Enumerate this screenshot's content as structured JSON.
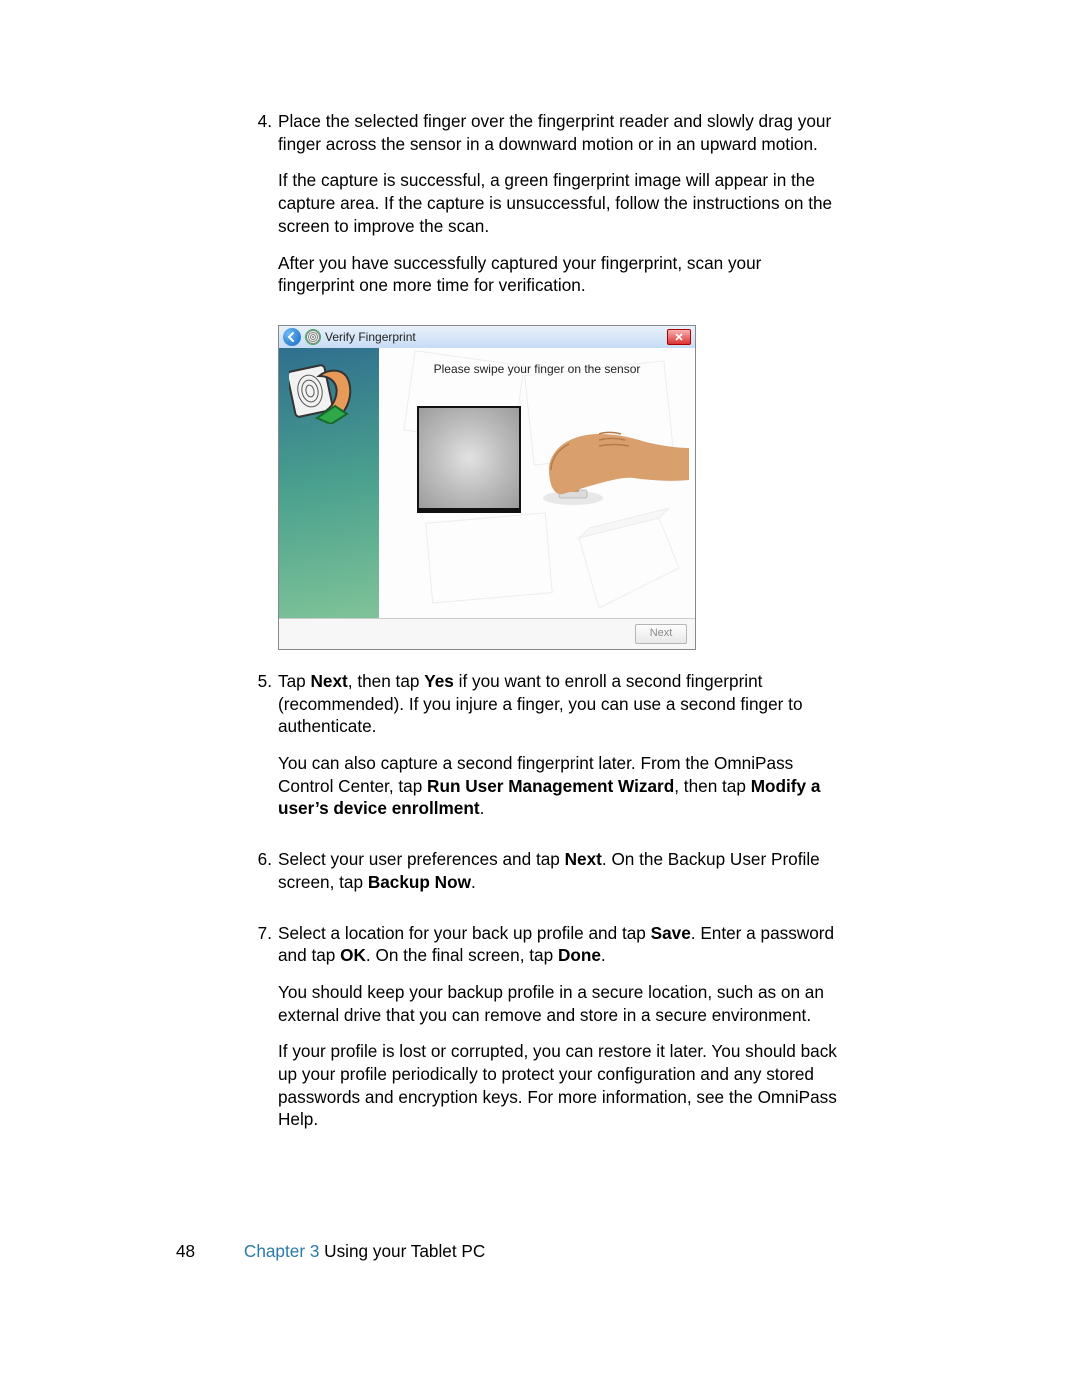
{
  "step4": {
    "num": "4.",
    "line1": "Place the selected finger over the fingerprint reader and slowly drag your finger across the sensor in a downward motion or in an upward motion.",
    "p2": "If the capture is successful, a green fingerprint image will appear in the capture area. If the capture is unsuccessful, follow the instructions on the screen to improve the scan.",
    "p3": "After you have successfully captured your fingerprint, scan your fingerprint one more time for verification."
  },
  "dialog": {
    "title": "Verify Fingerprint",
    "prompt": "Please swipe your finger on the sensor",
    "next_label": "Next",
    "close_label": "x"
  },
  "step5": {
    "num": "5.",
    "tap": "Tap ",
    "next_b": "Next",
    "mid1": ", then tap ",
    "yes_b": "Yes",
    "rest1": " if you want to enroll a second fingerprint (recommended). If you injure a finger, you can use a second finger to authenticate.",
    "p2_a": "You can also capture a second fingerprint later. From the OmniPass Control Center, tap ",
    "p2_b1": "Run User Management Wizard",
    "p2_mid": ", then tap ",
    "p2_b2": "Modify a user’s device enrollment",
    "p2_end": "."
  },
  "step6": {
    "num": "6.",
    "a": "Select your user preferences and tap ",
    "next_b": "Next",
    "b": ". On the Backup User Profile screen, tap ",
    "backup_b": "Backup Now",
    "end": "."
  },
  "step7": {
    "num": "7.",
    "a": "Select a location for your back up profile and tap ",
    "save_b": "Save",
    "b": ". Enter a password and tap ",
    "ok_b": "OK",
    "c": ". On the final screen, tap ",
    "done_b": "Done",
    "end": ".",
    "p2": "You should keep your backup profile in a secure location, such as on an external drive that you can remove and store in a secure environment.",
    "p3": "If your profile is lost or corrupted, you can restore it later. You should back up your profile periodically to protect your configuration and any stored passwords and encryption keys. For more information, see the OmniPass Help."
  },
  "footer": {
    "page": "48",
    "chapter_label": "Chapter 3",
    "chapter_title": "  Using your Tablet PC"
  }
}
